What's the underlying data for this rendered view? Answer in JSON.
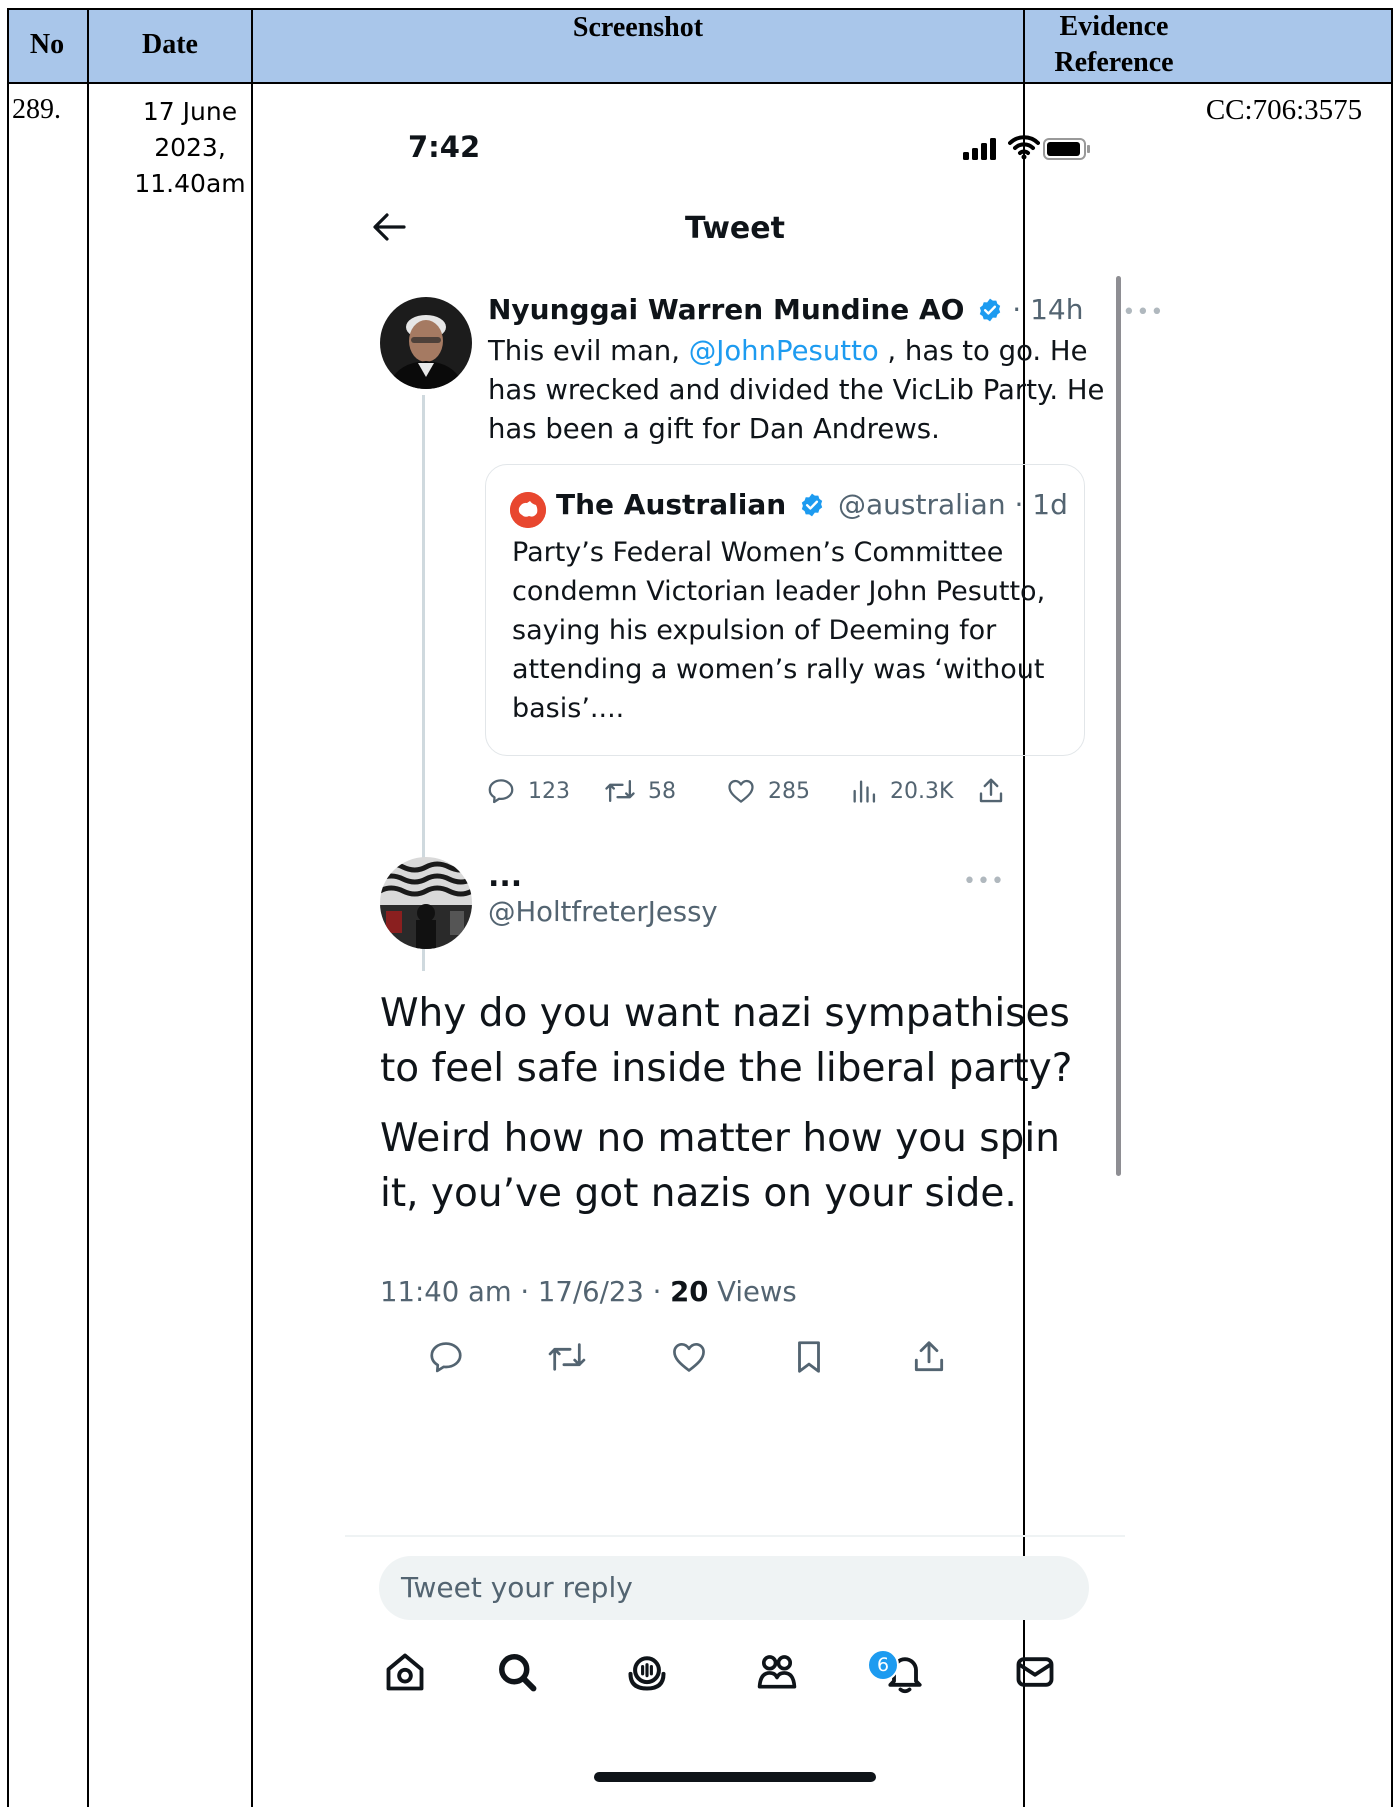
{
  "table": {
    "headers": {
      "no": "No",
      "date": "Date",
      "screenshot": "Screenshot",
      "evidence_ref_line1": "Evidence",
      "evidence_ref_line2": "Reference"
    },
    "row": {
      "no": "289.",
      "date_line1": "17 June",
      "date_line2": "2023,",
      "date_line3": "11.40am",
      "evidence_ref": "CC:706:3575"
    }
  },
  "phone": {
    "status_time": "7:42",
    "nav_title": "Tweet",
    "tweet1": {
      "author": "Nyunggai Warren Mundine AO",
      "age": "14h",
      "text_before_mention": "This evil man, ",
      "mention": "@JohnPesutto",
      "text_after_mention": " , has to go. He has wrecked and divided the VicLib Party. He has been a gift for Dan Andrews.",
      "quote": {
        "author": "The Australian",
        "handle_and_age": "@australian · 1d",
        "text": "Party’s Federal Women’s Committee condemn Victorian leader John Pesutto, saying his expulsion of Deeming for attending a women’s rally was ‘without basis’...."
      },
      "stats": {
        "replies": "123",
        "retweets": "58",
        "likes": "285",
        "views": "20.3K"
      }
    },
    "tweet2": {
      "name": "...",
      "handle": "@HoltfreterJessy",
      "text_p1": "Why do you want nazi sympathises to feel safe inside the liberal party?",
      "text_p2": "Weird how no matter how you spin it, you’ve got nazis on your side.",
      "time_date": "11:40 am · 17/6/23 · ",
      "views_count": "20",
      "views_label": " Views"
    },
    "reply_placeholder": "Tweet your reply",
    "notifications_badge": "6",
    "colors": {
      "link_blue": "#1d9bf0",
      "header_blue": "#a9c6ea",
      "australian_red": "#e8472f"
    },
    "icons": [
      "back-arrow-icon",
      "verified-badge-icon",
      "reply-icon",
      "retweet-icon",
      "like-icon",
      "views-icon",
      "share-icon",
      "bookmark-icon",
      "home-icon",
      "search-icon",
      "spaces-icon",
      "communities-icon",
      "notifications-icon",
      "messages-icon"
    ]
  }
}
